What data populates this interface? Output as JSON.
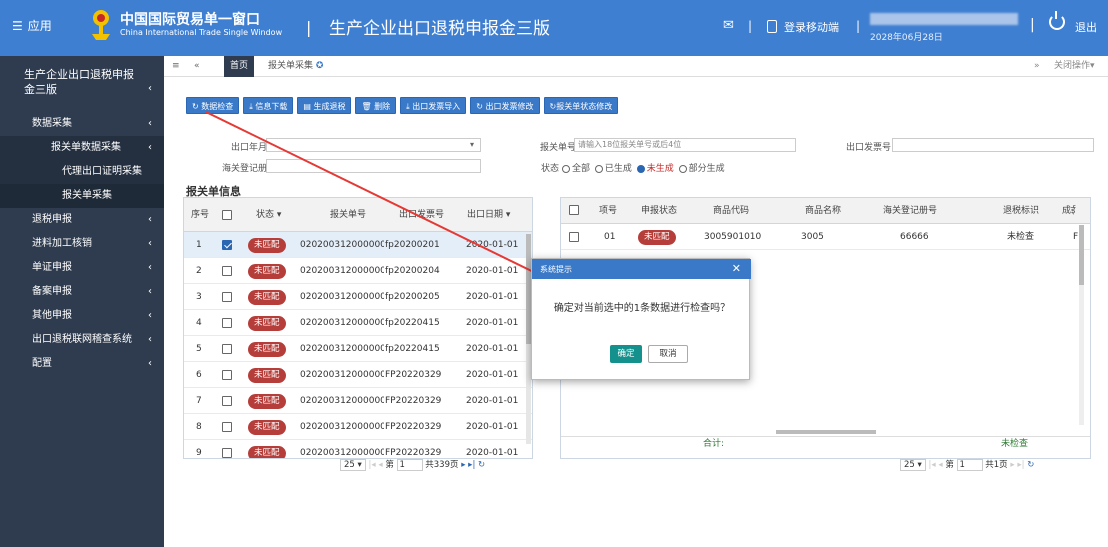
{
  "header": {
    "menu_label": "应用",
    "brand_cn": "中国国际贸易单一窗口",
    "brand_en": "China International Trade Single Window",
    "system_title": "生产企业出口退税申报金三版",
    "mobile_login": "登录移动端",
    "date_text": "2028年06月28日",
    "logout": "退出"
  },
  "sidebar": {
    "title": "生产企业出口退税申报金三版",
    "items": [
      {
        "label": "数据采集"
      },
      {
        "label": "报关单数据采集"
      },
      {
        "label": "代理出口证明采集"
      },
      {
        "label": "报关单采集"
      },
      {
        "label": "退税申报"
      },
      {
        "label": "进料加工核销"
      },
      {
        "label": "单证申报"
      },
      {
        "label": "备案申报"
      },
      {
        "label": "其他申报"
      },
      {
        "label": "出口退税联网稽查系统"
      },
      {
        "label": "配置"
      }
    ]
  },
  "tabs": {
    "home": "首页",
    "current": "报关单采集",
    "close_ops": "关闭操作"
  },
  "toolbar": {
    "buttons": [
      "数据检查",
      "信息下载",
      "生成退税",
      "删除",
      "出口发票导入",
      "出口发票修改",
      "报关单状态修改"
    ]
  },
  "filters": {
    "export_month_label": "出口年月",
    "declaration_no_label": "报关单号",
    "declaration_no_placeholder": "请输入18位报关单号或后4位",
    "invoice_no_label": "出口发票号",
    "customs_reg_label": "海关登记册号",
    "status_label": "状态",
    "status_options": [
      "全部",
      "已生成",
      "未生成",
      "部分生成"
    ],
    "status_selected": "未生成"
  },
  "left_table": {
    "title": "报关单信息",
    "headers": {
      "no": "序号",
      "status": "状态",
      "decl_no": "报关单号",
      "invoice": "出口发票号",
      "date": "出口日期"
    },
    "rows": [
      {
        "no": "1",
        "status": "未匹配",
        "decl_no": "02020031200000004",
        "invoice": "fp20200201",
        "date": "2020-01-01"
      },
      {
        "no": "2",
        "status": "未匹配",
        "decl_no": "02020031200000004",
        "invoice": "fp20200204",
        "date": "2020-01-01"
      },
      {
        "no": "3",
        "status": "未匹配",
        "decl_no": "02020031200000004",
        "invoice": "fp20200205",
        "date": "2020-01-01"
      },
      {
        "no": "4",
        "status": "未匹配",
        "decl_no": "02020031200000004",
        "invoice": "fp20220415",
        "date": "2020-01-01"
      },
      {
        "no": "5",
        "status": "未匹配",
        "decl_no": "02020031200000005",
        "invoice": "fp20220415",
        "date": "2020-01-01"
      },
      {
        "no": "6",
        "status": "未匹配",
        "decl_no": "02020031200000005",
        "invoice": "FP20220329",
        "date": "2020-01-01"
      },
      {
        "no": "7",
        "status": "未匹配",
        "decl_no": "02020031200000005",
        "invoice": "FP20220329",
        "date": "2020-01-01"
      },
      {
        "no": "8",
        "status": "未匹配",
        "decl_no": "02020031200000005",
        "invoice": "FP20220329",
        "date": "2020-01-01"
      },
      {
        "no": "9",
        "status": "未匹配",
        "decl_no": "02020031200000005",
        "invoice": "FP20220329",
        "date": "2020-01-01"
      }
    ],
    "pager": {
      "page_size": "25",
      "page_prefix": "第",
      "page": "1",
      "total": "共339页"
    }
  },
  "right_table": {
    "headers": {
      "item": "项号",
      "status": "申报状态",
      "code": "商品代码",
      "name": "商品名称",
      "reg": "海关登记册号",
      "flag": "退税标识",
      "cost": "成ई"
    },
    "rows": [
      {
        "item": "01",
        "status": "未匹配",
        "code": "3005901010",
        "name": "3005",
        "reg": "66666",
        "flag": "未检查",
        "cost": "F"
      }
    ],
    "summary": {
      "label": "合计:",
      "flag": "未检查"
    },
    "pager": {
      "page_size": "25",
      "page_prefix": "第",
      "page": "1",
      "total": "共1页"
    }
  },
  "dialog": {
    "title": "系统提示",
    "message": "确定对当前选中的1条数据进行检查吗？",
    "ok": "确定",
    "cancel": "取消"
  },
  "colors": {
    "header_bg": "#3f7fd1",
    "sidebar_bg": "#2f3c4f",
    "badge": "#b63e3a",
    "ok_button": "#14918c",
    "arrow": "#e53935"
  }
}
